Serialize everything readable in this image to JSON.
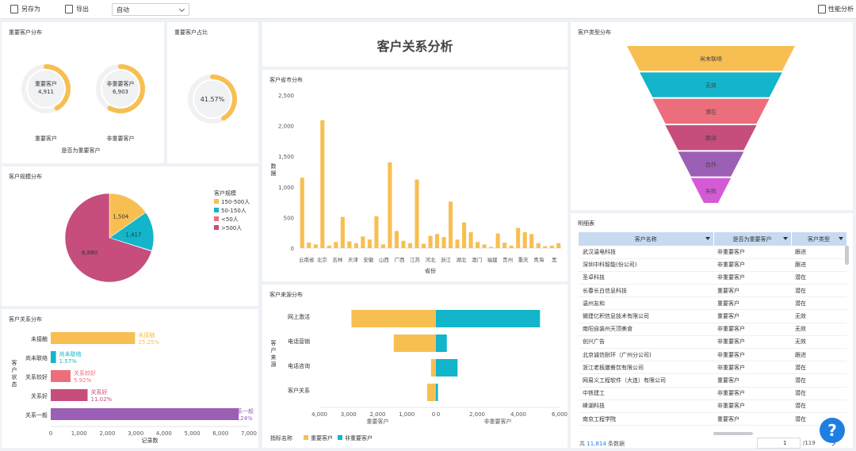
{
  "toolbar": {
    "save_as": "另存为",
    "export": "导出",
    "mode": "自动",
    "perf": "性能分析"
  },
  "main_title": "客户关系分析",
  "panels": {
    "important_dist": {
      "title": "重要客户分布",
      "gauges": [
        {
          "label": "重要客户",
          "value": "4,911",
          "axis_label": "重要客户",
          "fraction": 0.42
        },
        {
          "label": "非重要客户",
          "value": "6,903",
          "axis_label": "非重要客户",
          "fraction": 0.58
        }
      ],
      "xlabel": "是否为重要客户"
    },
    "important_ratio": {
      "title": "重要客户占比",
      "value": "41.57%",
      "fraction": 0.4157
    },
    "scale": {
      "title": "客户规模分布",
      "legend_title": "客户规模"
    },
    "relation": {
      "title": "客户关系分布"
    },
    "province": {
      "title": "客户省市分布"
    },
    "source": {
      "title": "客户来源分布"
    },
    "type": {
      "title": "客户类型分布"
    },
    "detail": {
      "title": "明细表"
    }
  },
  "charts": {
    "scale_pie": {
      "type": "pie",
      "legend": [
        {
          "label": "150-500人",
          "color": "#f7bf52"
        },
        {
          "label": "50-150人",
          "color": "#13b5cb"
        },
        {
          "label": "<50人",
          "color": "#ec6e7d"
        },
        {
          "label": ">500人",
          "color": "#c64d7c"
        }
      ],
      "slices": [
        {
          "value": 1504,
          "label": "1,504",
          "color": "#f7bf52"
        },
        {
          "value": 1417,
          "label": "1,417",
          "color": "#13b5cb"
        },
        {
          "value": 15,
          "label": "",
          "color": "#ec6e7d"
        },
        {
          "value": 6880,
          "label": "6,880",
          "color": "#c64d7c"
        }
      ]
    },
    "relation_bar": {
      "type": "bar",
      "ylabel": "客户状态",
      "xlabel": "记录数",
      "xticks": [
        "0",
        "1,000",
        "2,000",
        "3,000",
        "4,000",
        "5,000",
        "6,000",
        "7,000"
      ],
      "xmax": 7000,
      "bars": [
        {
          "category": "未接触",
          "value": 2980,
          "name": "未接触",
          "pct": "25.25%",
          "color": "#f7bf52"
        },
        {
          "category": "尚未联络",
          "value": 185,
          "name": "尚未联络",
          "pct": "1.57%",
          "color": "#13b5cb"
        },
        {
          "category": "关系较好",
          "value": 700,
          "name": "关系较好",
          "pct": "5.92%",
          "color": "#ec6e7d"
        },
        {
          "category": "关系好",
          "value": 1302,
          "name": "关系好",
          "pct": "11.02%",
          "color": "#c64d7c"
        },
        {
          "category": "关系一般",
          "value": 6640,
          "name": "关系一般",
          "pct": "56.24%",
          "color": "#9b5fb5"
        }
      ]
    },
    "province_bar": {
      "type": "bar",
      "ylabel": "数据",
      "xlabel": "省份",
      "ymax": 2500,
      "yticks": [
        "0",
        "500",
        "1,000",
        "1,500",
        "2,000",
        "2,500"
      ],
      "xticklabels": [
        "云南省",
        "北京",
        "吉林",
        "天津",
        "安徽",
        "山西",
        "广西",
        "江苏",
        "河北",
        "浙江",
        "湖北",
        "澳门",
        "福建",
        "贵州",
        "重庆",
        "青海",
        "黑"
      ],
      "values": [
        1150,
        90,
        60,
        2090,
        40,
        100,
        510,
        110,
        80,
        190,
        140,
        520,
        60,
        1400,
        280,
        120,
        80,
        1120,
        70,
        200,
        230,
        180,
        760,
        140,
        420,
        260,
        100,
        60,
        20,
        240,
        90,
        40,
        330,
        260,
        230,
        80,
        30,
        40,
        80
      ]
    },
    "source_bar": {
      "type": "bar",
      "ylabel": "客户来源",
      "legend_title": "指标名称",
      "xticks": [
        "4,000",
        "3,000",
        "2,000",
        "1,000",
        "0",
        "0",
        "2,000",
        "4,000",
        "6,000"
      ],
      "left_label": "重要客户",
      "right_label": "非重要客户",
      "series_names": [
        "重要客户",
        "非重要客户"
      ],
      "colors": [
        "#f7bf52",
        "#13b5cb"
      ],
      "rows": [
        {
          "category": "网上激活",
          "important": 2900,
          "nonimportant": 5050
        },
        {
          "category": "电话营销",
          "important": 1450,
          "nonimportant": 530
        },
        {
          "category": "电话咨询",
          "important": 170,
          "nonimportant": 1050
        },
        {
          "category": "客户关系",
          "important": 300,
          "nonimportant": 100
        }
      ]
    },
    "type_funnel": {
      "type": "funnel",
      "stages": [
        {
          "label": "尚未联络",
          "color": "#f7bf52"
        },
        {
          "label": "无效",
          "color": "#13b5cb"
        },
        {
          "label": "潜在",
          "color": "#ec6e7d"
        },
        {
          "label": "跟进",
          "color": "#c64d7c"
        },
        {
          "label": "合作",
          "color": "#9b5fb5"
        },
        {
          "label": "失败",
          "color": "#d55bd6"
        }
      ]
    }
  },
  "table": {
    "headers": [
      "客户名称",
      "是否为重要客户",
      "客户类型"
    ],
    "rows": [
      [
        "武汉温电科技",
        "非重要客户",
        "跟进"
      ],
      [
        "深圳中科智能(份公司)",
        "非重要客户",
        "跟进"
      ],
      [
        "圣卓科技",
        "非重要客户",
        "潜在"
      ],
      [
        "长春长白信息科技",
        "重要客户",
        "潜在"
      ],
      [
        "温州友和",
        "重要客户",
        "潜在"
      ],
      [
        "微建亿积信息技术有限公司",
        "重要客户",
        "无效"
      ],
      [
        "南阳自装州天顶美食",
        "非重要客户",
        "无效"
      ],
      [
        "创兴广告",
        "非重要客户",
        "无效"
      ],
      [
        "北京诚信耐环（广州分公司)",
        "非重要客户",
        "跟进"
      ],
      [
        "浙江老板膳餐饮有限公司",
        "非重要客户",
        "潜在"
      ],
      [
        "网易义工程软件（大连）有限公司",
        "重要客户",
        "潜在"
      ],
      [
        "中铁建工",
        "非重要客户",
        "潜在"
      ],
      [
        "峰湖科技",
        "非重要客户",
        "潜在"
      ],
      [
        "南京工程学院",
        "重要客户",
        "潜在"
      ]
    ],
    "footer_prefix": "共",
    "footer_count": "11,814",
    "footer_suffix": "条数据",
    "page": "1",
    "total_pages": "/119"
  },
  "help": "?"
}
